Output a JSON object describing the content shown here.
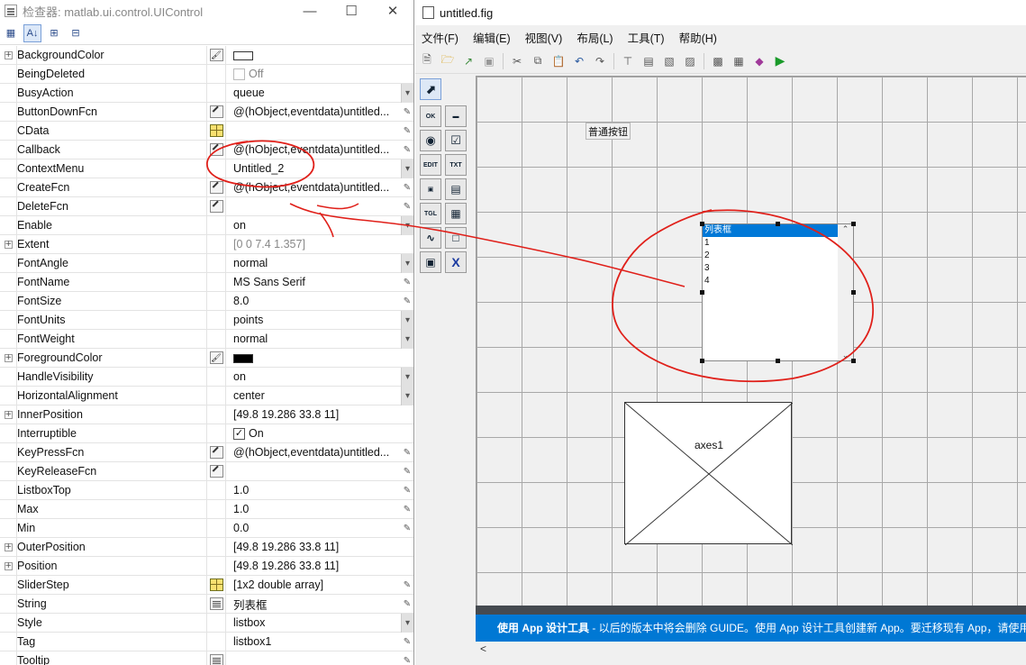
{
  "inspector": {
    "title": "检查器: matlab.ui.control.UIControl",
    "properties": [
      {
        "name": "BackgroundColor",
        "value": "",
        "expand": true,
        "btn": "paint",
        "swatch": "#ffffff"
      },
      {
        "name": "BeingDeleted",
        "value": "Off",
        "check": "off",
        "gray": true
      },
      {
        "name": "BusyAction",
        "value": "queue",
        "end": "dd"
      },
      {
        "name": "ButtonDownFcn",
        "value": "@(hObject,eventdata)untitled...",
        "btn": "pen",
        "end": "pen"
      },
      {
        "name": "CData",
        "value": "",
        "btn": "grid",
        "end": "pen"
      },
      {
        "name": "Callback",
        "value": "@(hObject,eventdata)untitled...",
        "btn": "pen",
        "end": "pen"
      },
      {
        "name": "ContextMenu",
        "value": "Untitled_2",
        "end": "dd"
      },
      {
        "name": "CreateFcn",
        "value": "@(hObject,eventdata)untitled...",
        "btn": "pen",
        "end": "pen"
      },
      {
        "name": "DeleteFcn",
        "value": "",
        "btn": "pen",
        "end": "pen"
      },
      {
        "name": "Enable",
        "value": "on",
        "end": "dd"
      },
      {
        "name": "Extent",
        "value": "[0 0 7.4 1.357]",
        "expand": true,
        "gray": true
      },
      {
        "name": "FontAngle",
        "value": "normal",
        "end": "dd"
      },
      {
        "name": "FontName",
        "value": "MS Sans Serif",
        "end": "pen"
      },
      {
        "name": "FontSize",
        "value": "8.0",
        "end": "pen"
      },
      {
        "name": "FontUnits",
        "value": "points",
        "end": "dd"
      },
      {
        "name": "FontWeight",
        "value": "normal",
        "end": "dd"
      },
      {
        "name": "ForegroundColor",
        "value": "",
        "expand": true,
        "btn": "paint",
        "swatch": "#000000"
      },
      {
        "name": "HandleVisibility",
        "value": "on",
        "end": "dd"
      },
      {
        "name": "HorizontalAlignment",
        "value": "center",
        "end": "dd"
      },
      {
        "name": "InnerPosition",
        "value": "[49.8 19.286 33.8 11]",
        "expand": true
      },
      {
        "name": "Interruptible",
        "value": "On",
        "check": "on"
      },
      {
        "name": "KeyPressFcn",
        "value": "@(hObject,eventdata)untitled...",
        "btn": "pen",
        "end": "pen"
      },
      {
        "name": "KeyReleaseFcn",
        "value": "",
        "btn": "pen",
        "end": "pen"
      },
      {
        "name": "ListboxTop",
        "value": "1.0",
        "end": "pen"
      },
      {
        "name": "Max",
        "value": "1.0",
        "end": "pen"
      },
      {
        "name": "Min",
        "value": "0.0",
        "end": "pen"
      },
      {
        "name": "OuterPosition",
        "value": "[49.8 19.286 33.8 11]",
        "expand": true
      },
      {
        "name": "Position",
        "value": "[49.8 19.286 33.8 11]",
        "expand": true
      },
      {
        "name": "SliderStep",
        "value": "[1x2  double array]",
        "btn": "grid",
        "end": "pen"
      },
      {
        "name": "String",
        "value": "列表框",
        "btn": "txt",
        "end": "pen"
      },
      {
        "name": "Style",
        "value": "listbox",
        "end": "dd"
      },
      {
        "name": "Tag",
        "value": "listbox1",
        "end": "pen"
      },
      {
        "name": "Tooltip",
        "value": "",
        "btn": "txt",
        "end": "pen"
      }
    ]
  },
  "figure": {
    "title": "untitled.fig",
    "menu": [
      "文件(F)",
      "编辑(E)",
      "视图(V)",
      "布局(L)",
      "工具(T)",
      "帮助(H)"
    ],
    "push_button": "普通按钮",
    "listbox_items": [
      "列表框",
      "1",
      "2",
      "3",
      "4"
    ],
    "axes_label": "axes1",
    "banner_bold": "使用 App 设计工具",
    "banner_text": " - 以后的版本中将会删除 GUIDE。使用 App 设计工具创建新 App。要迁移现有 App，请使用",
    "scroll_left": "<"
  },
  "annotation_color": "#e0201a"
}
